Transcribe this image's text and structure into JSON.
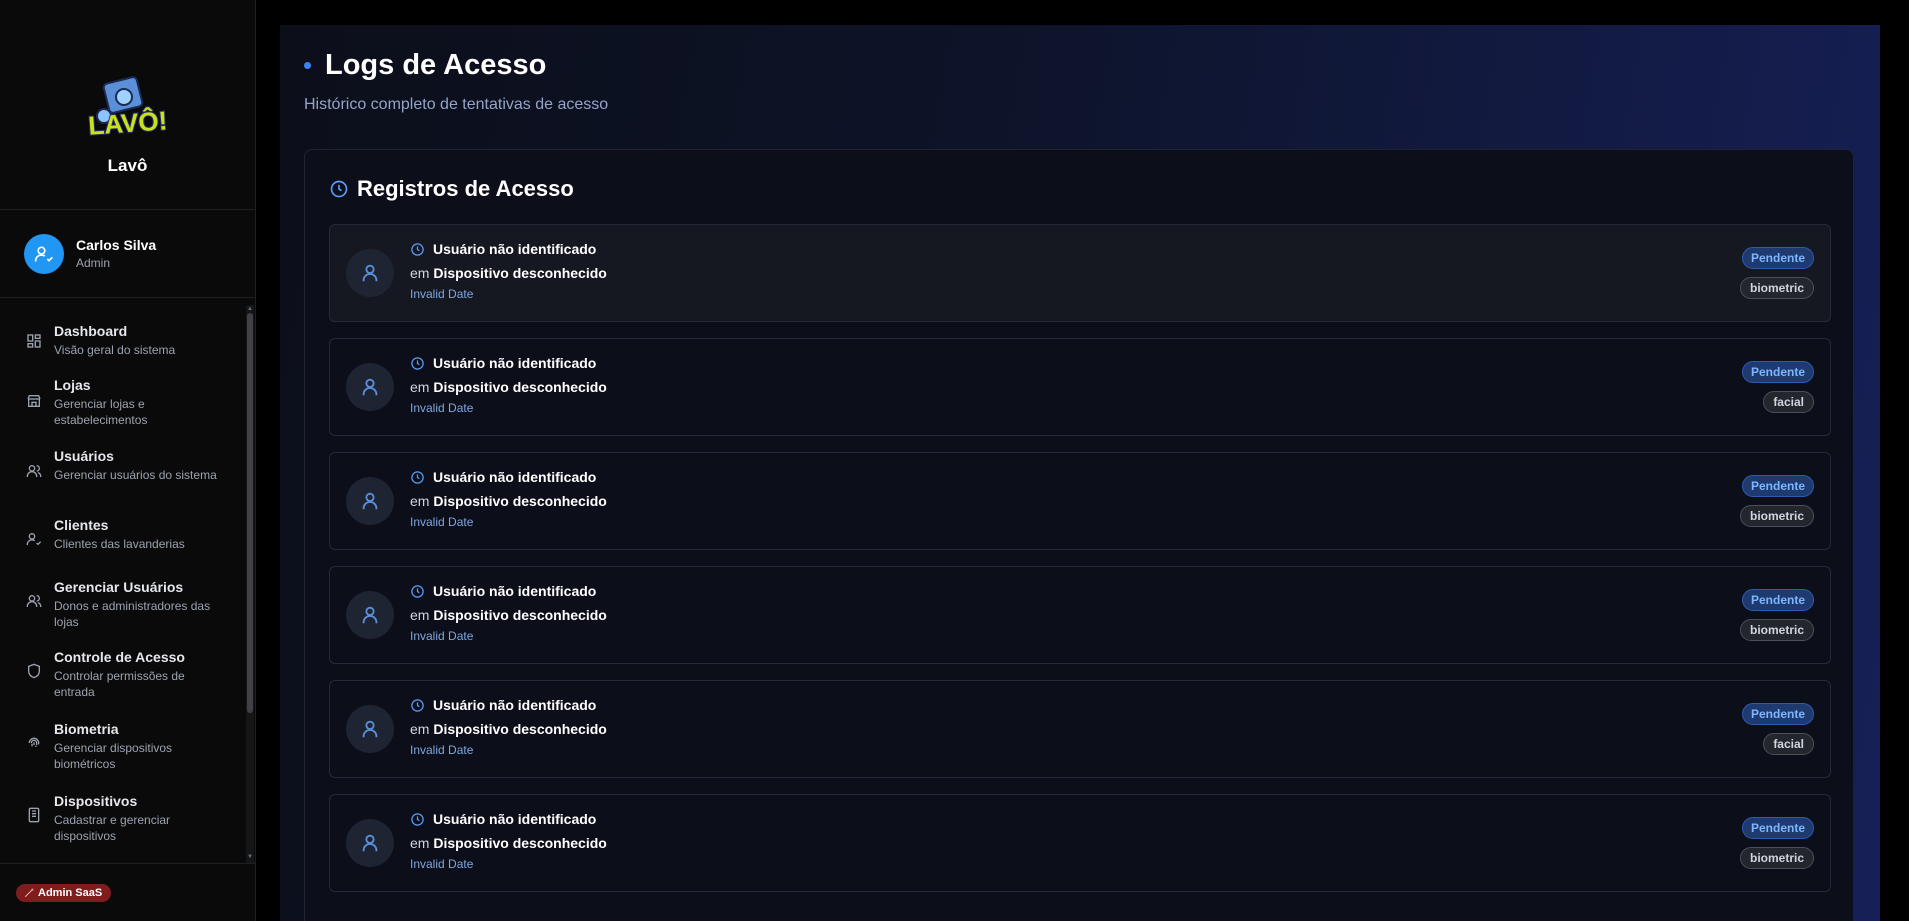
{
  "brand": {
    "name": "Lavô",
    "logo_text": "LAVÔ!"
  },
  "user": {
    "name": "Carlos Silva",
    "role": "Admin"
  },
  "nav": [
    {
      "title": "Dashboard",
      "desc": "Visão geral do sistema",
      "icon": "dashboard-icon"
    },
    {
      "title": "Lojas",
      "desc": "Gerenciar lojas e estabelecimentos",
      "icon": "store-icon"
    },
    {
      "title": "Usuários",
      "desc": "Gerenciar usuários do sistema",
      "icon": "users-icon"
    },
    {
      "title": "Clientes",
      "desc": "Clientes das lavanderias",
      "icon": "user-check-icon"
    },
    {
      "title": "Gerenciar Usuários",
      "desc": "Donos e administradores das lojas",
      "icon": "users-icon"
    },
    {
      "title": "Controle de Acesso",
      "desc": "Controlar permissões de entrada",
      "icon": "shield-icon"
    },
    {
      "title": "Biometria",
      "desc": "Gerenciar dispositivos biométricos",
      "icon": "fingerprint-icon"
    },
    {
      "title": "Dispositivos",
      "desc": "Cadastrar e gerenciar dispositivos",
      "icon": "device-icon"
    }
  ],
  "footer": {
    "admin_badge": "Admin SaaS"
  },
  "page": {
    "title": "Logs de Acesso",
    "subtitle": "Histórico completo de tentativas de acesso"
  },
  "card": {
    "title": "Registros de Acesso"
  },
  "logs": [
    {
      "user": "Usuário não identificado",
      "prefix": "em",
      "device": "Dispositivo desconhecido",
      "date": "Invalid Date",
      "status": "Pendente",
      "method": "biometric"
    },
    {
      "user": "Usuário não identificado",
      "prefix": "em",
      "device": "Dispositivo desconhecido",
      "date": "Invalid Date",
      "status": "Pendente",
      "method": "facial"
    },
    {
      "user": "Usuário não identificado",
      "prefix": "em",
      "device": "Dispositivo desconhecido",
      "date": "Invalid Date",
      "status": "Pendente",
      "method": "biometric"
    },
    {
      "user": "Usuário não identificado",
      "prefix": "em",
      "device": "Dispositivo desconhecido",
      "date": "Invalid Date",
      "status": "Pendente",
      "method": "biometric"
    },
    {
      "user": "Usuário não identificado",
      "prefix": "em",
      "device": "Dispositivo desconhecido",
      "date": "Invalid Date",
      "status": "Pendente",
      "method": "facial"
    },
    {
      "user": "Usuário não identificado",
      "prefix": "em",
      "device": "Dispositivo desconhecido",
      "date": "Invalid Date",
      "status": "Pendente",
      "method": "biometric"
    }
  ],
  "colors": {
    "accent": "#3b82f6",
    "avatar": "#2196f3",
    "admin_badge": "#7f1d1d"
  }
}
